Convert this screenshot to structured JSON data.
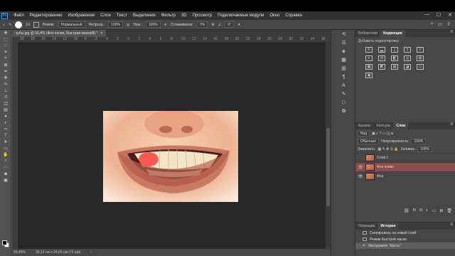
{
  "menu": {
    "logo": "Ps",
    "items": [
      "Файл",
      "Редактирование",
      "Изображение",
      "Слои",
      "Текст",
      "Выделение",
      "Фильтр",
      "3D",
      "Просмотр",
      "Подключаемые модули",
      "Окно",
      "Справка"
    ]
  },
  "options": {
    "brush_size": "10",
    "mode_label": "Режим:",
    "mode_value": "Нормальный",
    "opacity_label": "Непрозр.:",
    "opacity_value": "100%",
    "flow_label": "Наж.:",
    "flow_value": "100%",
    "smoothing_label": "Сглаживание:",
    "smoothing_value": "0%",
    "angle_value": "0°"
  },
  "document": {
    "tab_title": "зубы.jpg @ 56,4% (Фон копия, Быстрая маска/8) *",
    "ruler_ticks": [
      "20",
      "18",
      "16",
      "14",
      "12",
      "10",
      "8",
      "6",
      "4",
      "2",
      "0",
      "2",
      "4",
      "6",
      "8",
      "10",
      "12",
      "14",
      "16",
      "18",
      "20",
      "22",
      "24",
      "26",
      "28",
      "30",
      "32",
      "34",
      "36"
    ]
  },
  "status": {
    "zoom": "56,45%",
    "dimensions": "36,12 см x 24,05 см (72 ppi)"
  },
  "panels": {
    "tab_libraries": "Библиотеки",
    "tab_adjustments": "Коррекция",
    "add_adjustment_label": "Добавить корректировку",
    "tab_channels": "Каналы",
    "tab_paths": "Контуры",
    "tab_layers": "Слои",
    "filter_label": "Вид",
    "blend_mode": "Обычные",
    "opacity_label": "Непрозрачность:",
    "opacity_value": "100%",
    "lock_label": "Закрепить:",
    "fill_label": "Заливка:",
    "fill_value": "100%",
    "layers": [
      "Слой 1",
      "Фон копия",
      "Фон"
    ],
    "tab_operations": "Операции",
    "tab_history": "История",
    "history": [
      "Скопировать на новый слой",
      "Режим Быстрой маски",
      "Инструмент \"Кисть\""
    ]
  },
  "colors": {
    "canvas_bg": "#282828",
    "active_layer": "#8f4c4c",
    "quick_mask": "#ff2a2a"
  }
}
